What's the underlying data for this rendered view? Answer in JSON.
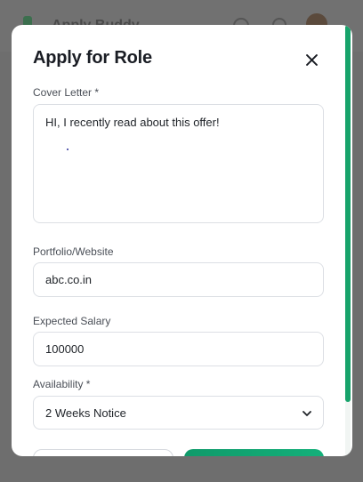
{
  "background": {
    "brand": "Apply Buddy",
    "icons": [
      "search-icon",
      "bell-icon"
    ]
  },
  "modal": {
    "title": "Apply for Role",
    "close_icon": "close-icon",
    "cover_letter": {
      "label": "Cover Letter *",
      "value": "HI, I recently read about this offer!"
    },
    "portfolio": {
      "label": "Portfolio/Website",
      "value": "abc.co.in"
    },
    "salary": {
      "label": "Expected Salary",
      "value": "100000"
    },
    "availability": {
      "label": "Availability *",
      "selected": "2 Weeks Notice"
    },
    "accent_color": "#17a36b"
  }
}
